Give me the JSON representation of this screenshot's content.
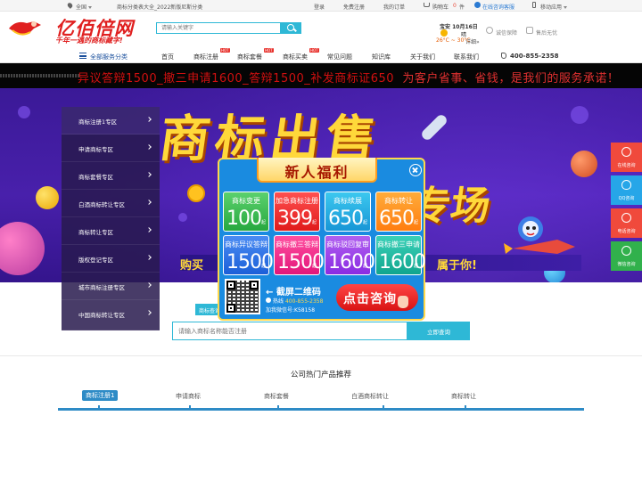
{
  "topbar": {
    "city": "全国",
    "promo": "商标分类表大全_2022新版尼斯分类",
    "login": "登录",
    "register": "免费注册",
    "orders": "我的订单",
    "cart_label": "购物车",
    "cart_count": "0",
    "cart_unit": "件",
    "online": "在线咨询客服",
    "mobile": "移动应用"
  },
  "header": {
    "logo_title": "亿佰倍网",
    "slogan": "千年一遇的商标藏字!",
    "search_placeholder": "请输入关键字",
    "weather": {
      "city": "宝安 10月16日",
      "desc": "晴",
      "temp": "26°C ~ 30°C",
      "detail": "详细»"
    },
    "badge1": "诚信保障",
    "badge2": "售后无忧"
  },
  "nav": {
    "categories_label": "全部服务分类",
    "items": [
      {
        "label": "首页",
        "hot": ""
      },
      {
        "label": "商标注册",
        "hot": "HOT"
      },
      {
        "label": "商标套餐",
        "hot": "HOT"
      },
      {
        "label": "商标买卖",
        "hot": "HOT"
      },
      {
        "label": "常见问题",
        "hot": ""
      },
      {
        "label": "知识库",
        "hot": ""
      },
      {
        "label": "关于我们",
        "hot": ""
      },
      {
        "label": "联系我们",
        "hot": ""
      }
    ],
    "phone": "400-855-2358"
  },
  "ticker": {
    "text": "异议答辩1500_撤三申请1600_答辩1500_补发商标证650",
    "text2": "为客户省事、省钱，是我们的服务承诺！"
  },
  "banner": {
    "title": "商标出售",
    "title2": "专场",
    "strip_left": "购买",
    "strip_right": "属于你!"
  },
  "side_menu": [
    "商标注册1专区",
    "申请商标专区",
    "商标套餐专区",
    "白酒商标转让专区",
    "商标转让专区",
    "版权登记专区",
    "城市商标注册专区",
    "中国商标转让专区"
  ],
  "float_bar": [
    "在线咨询",
    "QQ咨询",
    "电话咨询",
    "微信咨询"
  ],
  "popup": {
    "title": "新人福利",
    "cards": [
      {
        "name": "商标变更",
        "price": "100",
        "unit": "起",
        "color": "green"
      },
      {
        "name": "加急商标注册",
        "price": "399",
        "unit": "起",
        "color": "red"
      },
      {
        "name": "商标续展",
        "price": "650",
        "unit": "起",
        "color": "cyan"
      },
      {
        "name": "商标转让",
        "price": "650",
        "unit": "起",
        "color": "orange"
      },
      {
        "name": "商标异议答辩",
        "price": "1500",
        "unit": "起",
        "color": "blue"
      },
      {
        "name": "商标撤三答辩",
        "price": "1500",
        "unit": "起",
        "color": "pink"
      },
      {
        "name": "商标驳回复审",
        "price": "1600",
        "unit": "起",
        "color": "purple"
      },
      {
        "name": "商标撤三申请",
        "price": "1600",
        "unit": "起",
        "color": "teal"
      }
    ],
    "scan_text": "← 截屏二维码",
    "hotline_label": "热线",
    "hotline": "400-855-2358",
    "wechat": "加我微信号:K58158",
    "consult": "点击咨询"
  },
  "query": {
    "tab": "商标查询",
    "placeholder": "请输入商标名称能否注册",
    "button": "立即查询"
  },
  "hot_products": {
    "title": "公司热门产品推荐",
    "tabs": [
      "商标注册1",
      "申请商标",
      "商标套餐",
      "白酒商标转让",
      "商标转让"
    ]
  },
  "colors": {
    "brand_red": "#e02020",
    "accent_blue": "#2eb8d6",
    "nav_blue": "#1a4f9c"
  }
}
